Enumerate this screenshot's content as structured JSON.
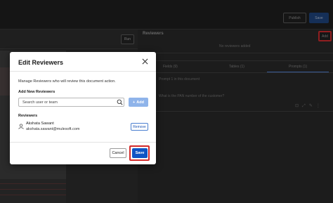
{
  "background": {
    "topbar": {
      "publish_label": "Publish",
      "save_label": "Save"
    },
    "left_panel": {
      "run_label": "Run"
    },
    "right_panel": {
      "reviewers_title": "Reviewers",
      "add_label": "Add",
      "no_reviewers_text": "No reviewers added",
      "tabs": [
        "Fields (9)",
        "Tables (1)",
        "Prompts (1)"
      ],
      "prompt_hint": "Prompt 1 in this document",
      "prompt_question": "What is the PAN number of the customer?"
    }
  },
  "modal": {
    "title": "Edit Reviewers",
    "description": "Manage Reviewers who will review this document action.",
    "add_section_label": "Add New Reviewers",
    "search": {
      "placeholder": "Search user or team",
      "value": ""
    },
    "add_button_label": "Add",
    "reviewers_label": "Reviewers",
    "reviewers": [
      {
        "name": "Akshata Sawant",
        "email": "akshata.sawant@mulesoft.com",
        "remove_label": "Remove"
      }
    ],
    "cancel_label": "Cancel",
    "save_label": "Save"
  },
  "colors": {
    "primary": "#0f55c4",
    "primary_disabled": "#8fb4ea",
    "highlight": "#d32a2a"
  }
}
